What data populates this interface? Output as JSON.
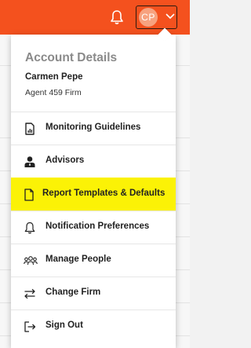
{
  "topbar": {
    "bell_icon": "bell-icon",
    "user": {
      "initials": "CP",
      "chevron_icon": "chevron-down-icon"
    },
    "color": "#f4511e"
  },
  "account_menu": {
    "title": "Account Details",
    "name": "Carmen Pepe",
    "firm": "Agent 459 Firm",
    "highlight_color": "#fbf206",
    "items": [
      {
        "label": "Monitoring Guidelines",
        "icon": "document-chart-icon"
      },
      {
        "label": "Advisors",
        "icon": "advisor-person-icon"
      },
      {
        "label": "Report Templates & Defaults",
        "icon": "document-icon",
        "highlighted": true
      },
      {
        "label": "Notification Preferences",
        "icon": "bell-icon"
      },
      {
        "label": "Manage People",
        "icon": "people-icon"
      },
      {
        "label": "Change Firm",
        "icon": "swap-arrows-icon"
      },
      {
        "label": "Sign Out",
        "icon": "sign-out-icon"
      }
    ]
  }
}
